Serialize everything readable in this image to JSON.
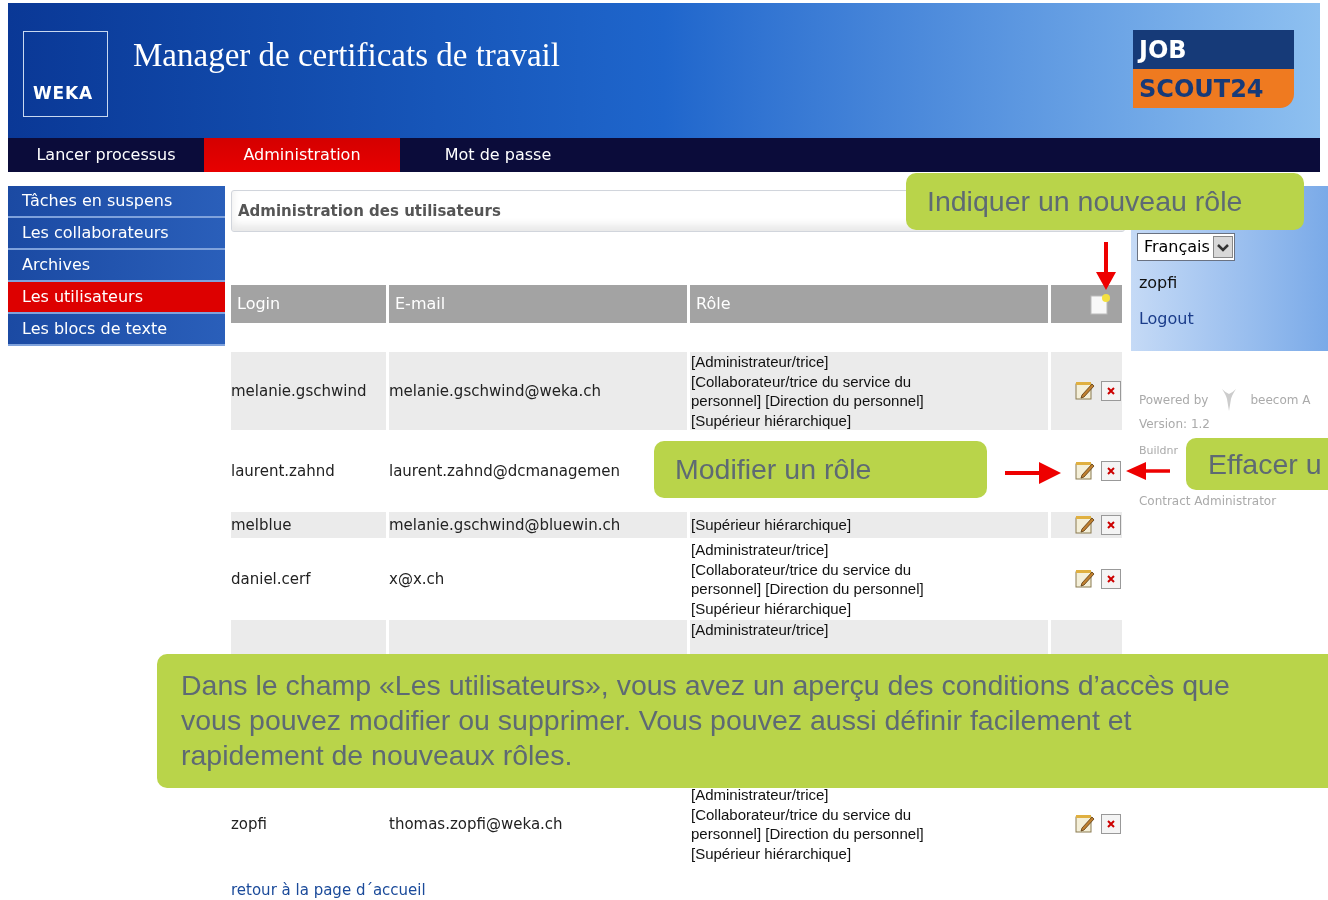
{
  "header": {
    "title": "Manager de certificats de travail",
    "logo": "WEKA",
    "partner_logo": [
      "JOB",
      "SCOUT24"
    ]
  },
  "nav": [
    {
      "label": "Lancer processus",
      "selected": false
    },
    {
      "label": "Administration",
      "selected": true
    },
    {
      "label": "Mot de passe",
      "selected": false
    }
  ],
  "sidebar": [
    {
      "label": "Tâches en suspens",
      "selected": false
    },
    {
      "label": "Les collaborateurs",
      "selected": false
    },
    {
      "label": "Archives",
      "selected": false
    },
    {
      "label": "Les utilisateurs",
      "selected": true
    },
    {
      "label": "Les blocs de texte",
      "selected": false
    }
  ],
  "panel": {
    "title": "Administration des utilisateurs"
  },
  "table": {
    "columns": [
      "Login",
      "E-mail",
      "Rôle"
    ],
    "rows": [
      {
        "login": "melanie.gschwind",
        "email": "melanie.gschwind@weka.ch",
        "role_lines": [
          "[Administrateur/trice]",
          "[Collaborateur/trice du service du",
          "personnel] [Direction du personnel]",
          "[Supérieur hiérarchique]"
        ],
        "kind": "full",
        "actions": true
      },
      {
        "login": "laurent.zahnd",
        "email": "laurent.zahnd@dcmanagemen",
        "kind": "partial",
        "actions": true
      },
      {
        "login": "melblue",
        "email": "melanie.gschwind@bluewin.ch",
        "role_lines": [
          "[Supérieur hiérarchique]"
        ],
        "kind": "full",
        "actions": true
      },
      {
        "login": "daniel.cerf",
        "email": "x@x.ch",
        "role_lines": [
          "[Administrateur/trice]",
          "[Collaborateur/trice du service du",
          "personnel] [Direction du personnel]",
          "[Supérieur hiérarchique]"
        ],
        "kind": "full",
        "actions": true
      },
      {
        "role_lines": [
          "[Administrateur/trice]"
        ],
        "kind": "partial",
        "actions": false
      },
      {
        "login": "zopfi",
        "email": "thomas.zopfi@weka.ch",
        "role_lines": [
          "[Administrateur/trice]",
          "[Collaborateur/trice du service du",
          "personnel] [Direction du personnel]",
          "[Supérieur hiérarchique]"
        ],
        "kind": "full",
        "actions": true
      }
    ]
  },
  "user_panel": {
    "language": "Français",
    "user": "zopfi",
    "logout": "Logout"
  },
  "info": {
    "powered_by": "Powered by",
    "company": "beecom A",
    "version": "Version: 1.2",
    "build": "Buildnr",
    "contract": "Contract Administrator"
  },
  "footer_link": "retour à la page d´accueil",
  "callouts": [
    {
      "kind": "new-role",
      "text": "Indiquer un nouveau rôle"
    },
    {
      "kind": "edit-role",
      "text": "Modifier un rôle"
    },
    {
      "kind": "delete-role",
      "text": "Effacer u"
    },
    {
      "kind": "summary",
      "text": "Dans le champ «Les utilisateurs», vous avez un aperçu des conditions d’accès que vous pouvez modifier ou supprimer. Vous pouvez aussi définir facilement et rapidement de nouveaux rôles."
    }
  ]
}
